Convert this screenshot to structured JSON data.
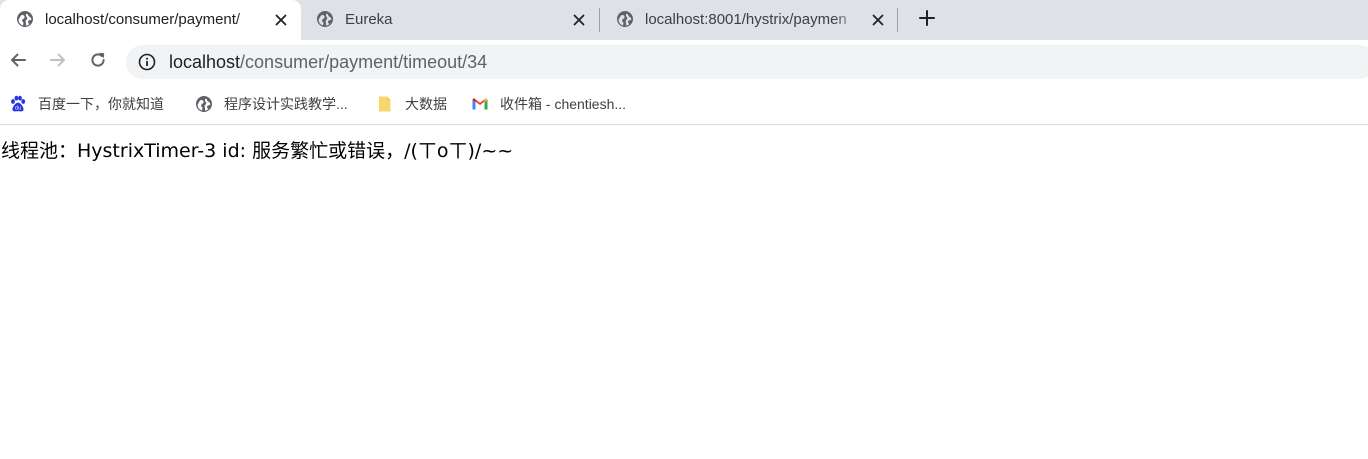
{
  "colors": {
    "tabstrip_bg": "#dee1e6",
    "omnibox_bg": "#f1f3f4",
    "gmail_red": "#ea4335",
    "baidu_blue": "#2932e1",
    "folder_yellow": "#f9d66c"
  },
  "tabs": [
    {
      "title": "localhost/consumer/payment/",
      "icon": "globe-icon",
      "active": true
    },
    {
      "title": "Eureka",
      "icon": "globe-icon",
      "active": false
    },
    {
      "title": "localhost:8001/hystrix/paymen",
      "icon": "globe-icon",
      "active": false
    }
  ],
  "toolbar": {
    "url_host": "localhost",
    "url_path": "/consumer/payment/timeout/34"
  },
  "bookmarks": [
    {
      "label": "百度一下，你就知道",
      "icon": "baidu-paw-icon"
    },
    {
      "label": "程序设计实践教学...",
      "icon": "globe-icon"
    },
    {
      "label": "大数据",
      "icon": "folder-icon"
    },
    {
      "label": "收件箱 - chentiesh...",
      "icon": "gmail-icon"
    }
  ],
  "page": {
    "response_text": "线程池：HystrixTimer-3 id: 服务繁忙或错误，/(ㄒoㄒ)/~~"
  }
}
